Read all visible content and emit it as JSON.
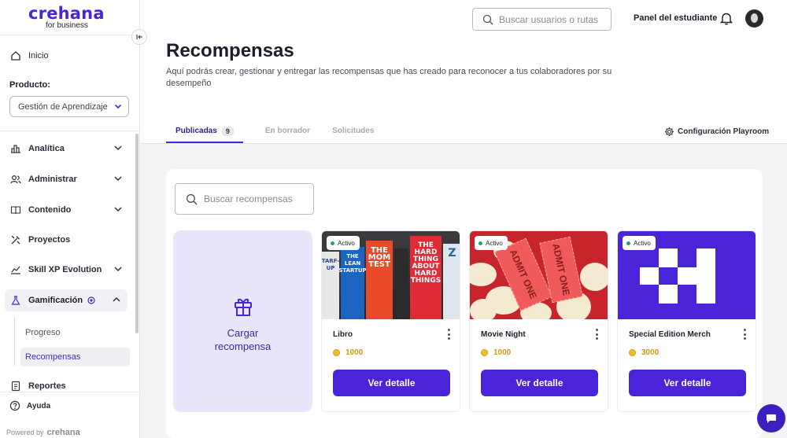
{
  "brand": {
    "name": "crehana",
    "sub": "for business",
    "powered_by": "Powered by",
    "powered_brand": "crehana"
  },
  "sidebar": {
    "inicio": "Inicio",
    "product_label": "Producto:",
    "product_value": "Gestión de Aprendizaje",
    "items": [
      {
        "label": "Analítica"
      },
      {
        "label": "Administrar"
      },
      {
        "label": "Contenido"
      },
      {
        "label": "Proyectos"
      },
      {
        "label": "Skill XP Evolution"
      },
      {
        "label": "Gamificación"
      },
      {
        "label": "Reportes"
      }
    ],
    "sub_items": [
      {
        "label": "Progreso"
      },
      {
        "label": "Recompensas"
      }
    ],
    "help": "Ayuda"
  },
  "header": {
    "search_placeholder": "Buscar usuarios o rutas",
    "panel_link": "Panel del estudiante"
  },
  "page": {
    "title": "Recompensas",
    "description": "Aquí podrás crear, gestionar y entregar las recompensas que has creado para reconocer a tus colaboradores por su desempeño",
    "tabs": [
      {
        "label": "Publicadas",
        "count": "9"
      },
      {
        "label": "En borrador"
      },
      {
        "label": "Solicitudes"
      }
    ],
    "config_label": "Configuración Playroom",
    "search_rewards_placeholder": "Buscar recompensas",
    "upload_label": "Cargar recompensa"
  },
  "rewards": [
    {
      "status": "Activo",
      "name": "Libro",
      "points": "1000",
      "button": "Ver detalle"
    },
    {
      "status": "Activo",
      "name": "Movie Night",
      "points": "1000",
      "button": "Ver detalle"
    },
    {
      "status": "Activo",
      "name": "Special Edition Merch",
      "points": "3000",
      "button": "Ver detalle"
    }
  ],
  "book_covers": [
    {
      "text": "TARF-UP"
    },
    {
      "text": "THE LEAN STARTUP"
    },
    {
      "text": "THE MOM TEST"
    },
    {
      "text": "THE HARD THING ABOUT HARD THINGS"
    },
    {
      "text": "Z"
    }
  ],
  "ticket_text": {
    "a": "ADMIT ONE",
    "b": "ADMIT ONE"
  },
  "colors": {
    "accent": "#4a24d8",
    "active_dot": "#1fa36a",
    "points": "#c79a16",
    "upload_bg": "#e9e6fb"
  }
}
